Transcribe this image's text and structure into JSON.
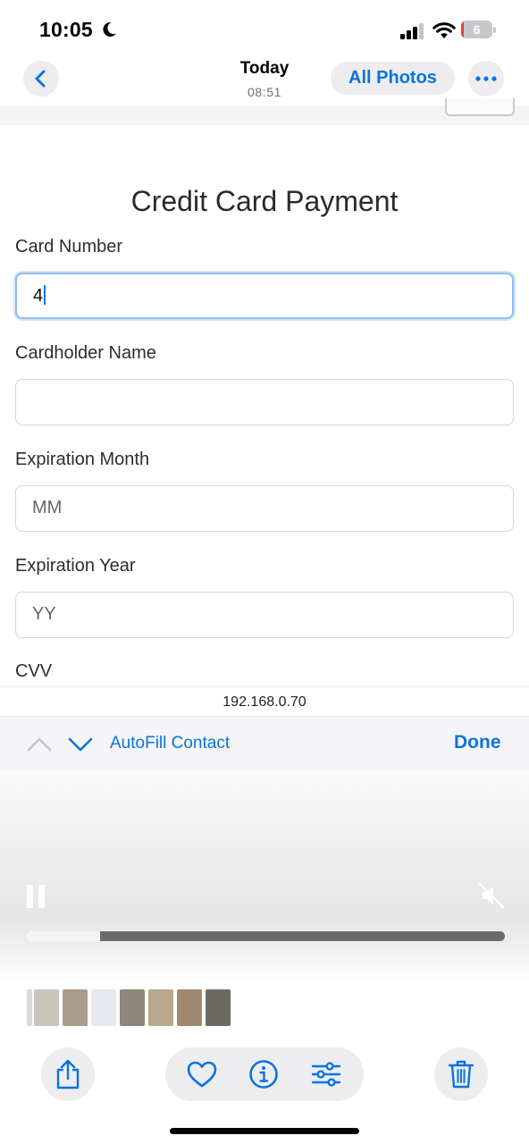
{
  "status_bar": {
    "time": "10:05",
    "battery_level": "6",
    "icons": [
      "moon-icon",
      "signal-icon",
      "wifi-icon",
      "battery-icon"
    ],
    "battery_fraction": 0.06
  },
  "nav": {
    "title": "Today",
    "subtitle": "08:51",
    "all_photos_label": "All Photos",
    "icons": [
      "chevron-left-icon",
      "ellipsis-icon"
    ]
  },
  "form": {
    "title": "Credit Card Payment",
    "card_number_label": "Card Number",
    "card_number_value": "4",
    "cardholder_label": "Cardholder Name",
    "cardholder_value": "",
    "exp_month_label": "Expiration Month",
    "exp_month_placeholder": "MM",
    "exp_year_label": "Expiration Year",
    "exp_year_placeholder": "YY",
    "cvv_label": "CVV"
  },
  "browser": {
    "url": "192.168.0.70"
  },
  "keyboard_accessory": {
    "autofill_label": "AutoFill Contact",
    "done_label": "Done",
    "icons": [
      "chevron-up-icon",
      "chevron-down-icon"
    ]
  },
  "video": {
    "progress": 0.157,
    "icons": [
      "pause-icon",
      "speaker-muted-icon"
    ]
  },
  "thumbnails": {
    "count": 8,
    "colors": [
      "#d9d9d9",
      "#c9c5bb",
      "#a99c88",
      "#e6e8ee",
      "#8c8778",
      "#b8a88c",
      "#9f8a6e",
      "#6d6a63"
    ]
  },
  "toolbar": {
    "icons": [
      "share-icon",
      "heart-icon",
      "info-icon",
      "adjust-icon",
      "trash-icon"
    ]
  },
  "colors": {
    "accent": "#0a74dc",
    "button_background": "#ededf0",
    "focus_ring": "#8fbdf0"
  }
}
